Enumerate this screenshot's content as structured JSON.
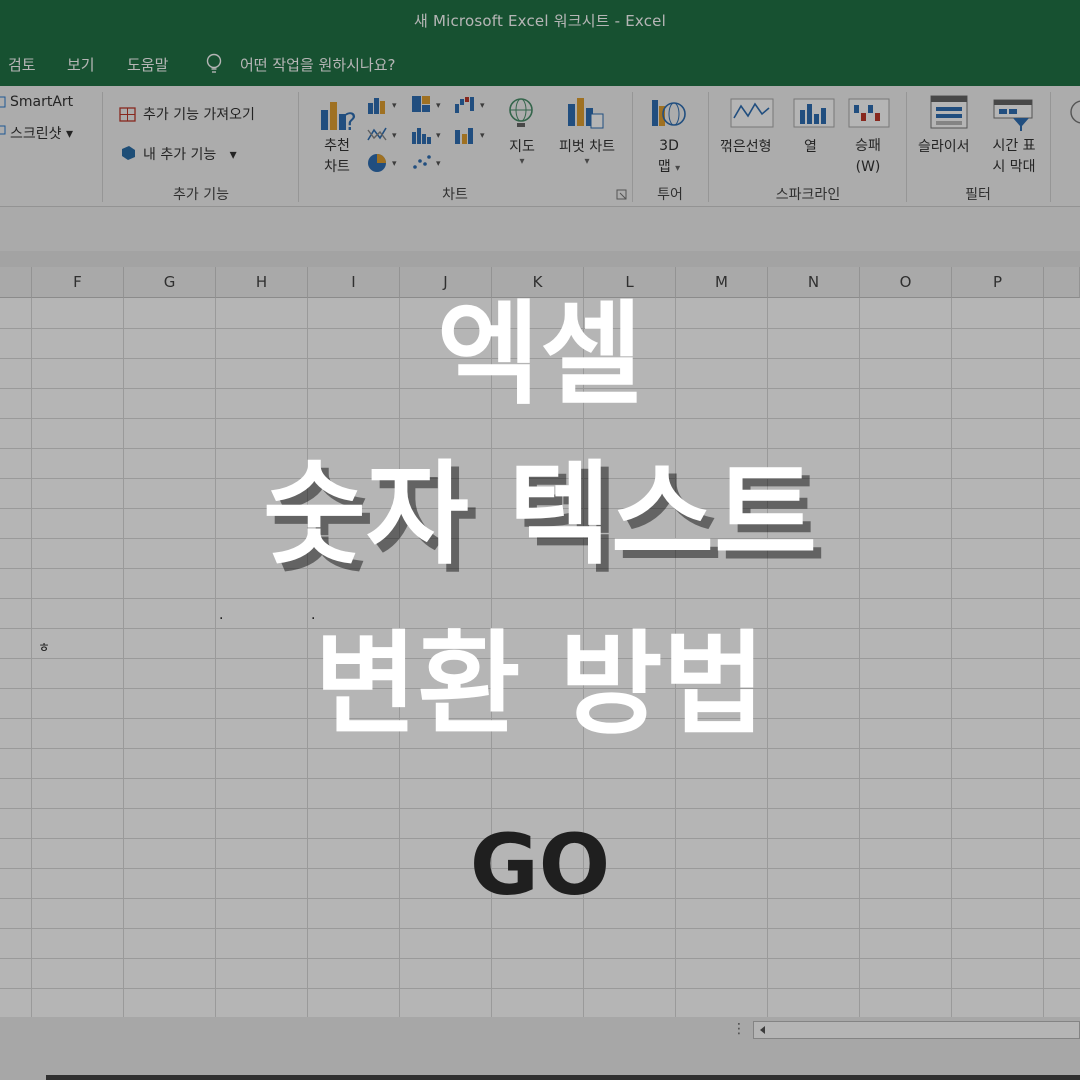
{
  "window": {
    "title": "새 Microsoft Excel 워크시트  -  Excel"
  },
  "menu": {
    "review": "검토",
    "view": "보기",
    "help": "도움말",
    "tell_me": "어떤 작업을 원하시나요?"
  },
  "ribbon": {
    "smartart": "SmartArt",
    "screenshot": "스크린샷",
    "get_addins": "추가 기능 가져오기",
    "my_addins": "내 추가 기능",
    "addins_group": "추가 기능",
    "recommended_charts_1": "추천",
    "recommended_charts_2": "차트",
    "maps": "지도",
    "pivot_chart": "피벗 차트",
    "charts_group": "차트",
    "map3d_1": "3D",
    "map3d_2": "맵",
    "tours_group": "투어",
    "spark_line": "꺾은선형",
    "spark_column": "열",
    "spark_winloss_1": "승패",
    "spark_winloss_2": "(W)",
    "sparklines_group": "스파크라인",
    "slicer": "슬라이서",
    "timeline_1": "시간 표",
    "timeline_2": "시 막대",
    "filters_group": "필터"
  },
  "grid": {
    "columns": [
      "F",
      "G",
      "H",
      "I",
      "J",
      "K",
      "L",
      "M",
      "N",
      "O",
      "P"
    ],
    "cell_text": "ㅎ",
    "dot": "."
  },
  "overlay": {
    "line1": "엑셀",
    "line2": "숫자 텍스트",
    "line3": "변환 방법",
    "go": "GO"
  },
  "colors": {
    "excel_green": "#217346",
    "ribbon_bg": "#f3f3f3",
    "overlay_text": "#ffffff",
    "go_text": "#1f1f1f"
  }
}
